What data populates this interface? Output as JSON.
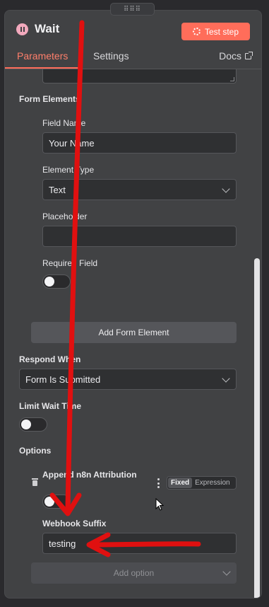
{
  "node": {
    "title": "Wait",
    "test_button": "Test step",
    "icon": "pause-icon"
  },
  "tabs": {
    "parameters": "Parameters",
    "settings": "Settings",
    "docs": "Docs"
  },
  "form_elements": {
    "section_label": "Form Elements",
    "field_name_label": "Field Name",
    "field_name_value": "Your Name",
    "element_type_label": "Element Type",
    "element_type_value": "Text",
    "placeholder_label": "Placeholder",
    "placeholder_value": "",
    "required_label": "Required Field",
    "add_button": "Add Form Element"
  },
  "respond_when": {
    "label": "Respond When",
    "value": "Form Is Submitted"
  },
  "limit_wait": {
    "label": "Limit Wait Time"
  },
  "options": {
    "label": "Options",
    "attribution_label": "Append n8n Attribution",
    "mode_fixed": "Fixed",
    "mode_expression": "Expression",
    "webhook_label": "Webhook Suffix",
    "webhook_value": "testing",
    "add_option": "Add option"
  },
  "colors": {
    "accent": "#ff6d5a",
    "annotation": "#e01010",
    "panel": "#414244"
  }
}
